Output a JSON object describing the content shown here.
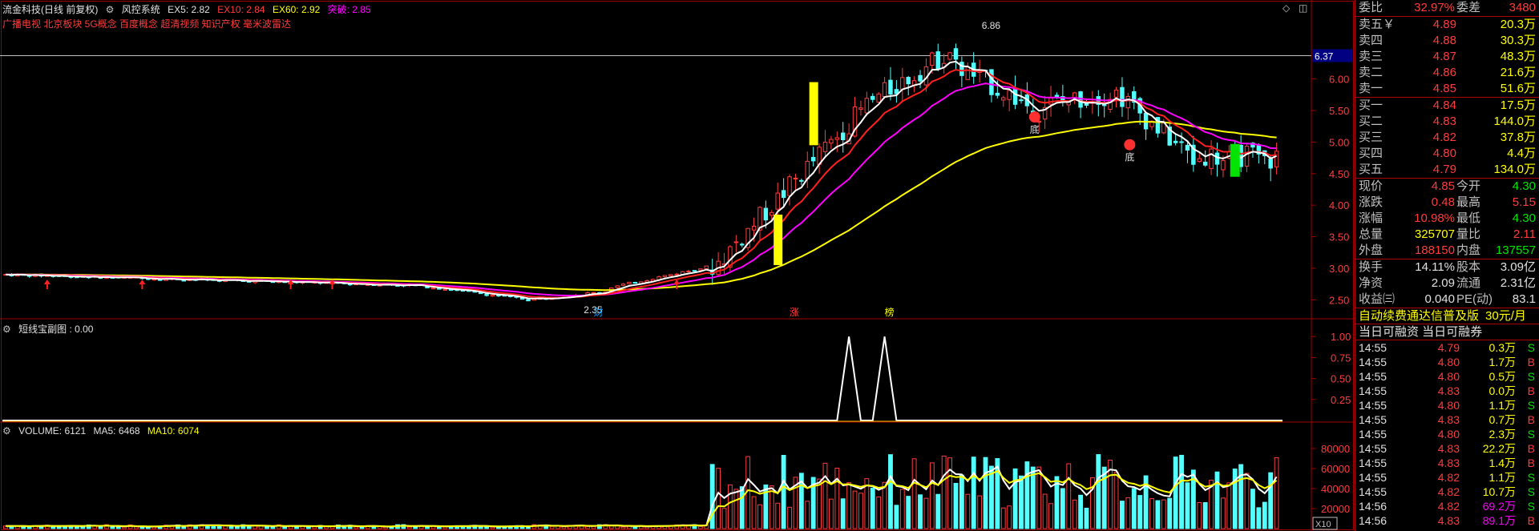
{
  "header": {
    "title": "流金科技(日线 前复权)",
    "indicator_name": "风控系统",
    "ex5": "EX5: 2.82",
    "ex10": "EX10: 2.84",
    "ex60": "EX60: 2.92",
    "breakout": "突破: 2.85",
    "concepts": "广播电视 北京板块 5G概念 百度概念 超清视频 知识产权 毫米波雷达"
  },
  "main_chart": {
    "price_axis": [
      "6.00",
      "5.50",
      "5.00",
      "4.50",
      "4.00",
      "3.50",
      "3.00",
      "2.50"
    ],
    "price_min": 2.2,
    "price_max": 7.15,
    "current_price_tag": "6.37",
    "high_label": "6.86",
    "low_label": "2.35",
    "markers": [
      {
        "text": "财",
        "color": "#00a0ff"
      },
      {
        "text": "涨",
        "color": "#ff3c3c"
      },
      {
        "text": "榜",
        "color": "#ffff00"
      }
    ],
    "signal_labels": [
      "底",
      "底"
    ]
  },
  "sub_chart": {
    "title": "短线宝副图 : 0.00",
    "axis": [
      "1.00",
      "0.75",
      "0.50",
      "0.25"
    ]
  },
  "volume_chart": {
    "title": "VOLUME: 6121",
    "ma5": "MA5: 6468",
    "ma10": "MA10: 6074",
    "axis": [
      "80000",
      "60000",
      "40000",
      "20000"
    ],
    "unit": "X10",
    "vmax": 92000
  },
  "colors": {
    "up": "#ff3c3c",
    "down": "#54ffff",
    "ma5": "#ffffff",
    "ma10": "#ff2020",
    "ma20": "#ff00ff",
    "ma60": "#ffff00"
  },
  "quote": {
    "weibi_label": "委比",
    "weibi_value": "32.97%",
    "weicha_label": "委差",
    "weicha_value": "3480",
    "sells": [
      {
        "label": "卖五￥",
        "price": "4.89",
        "vol": "20.3万"
      },
      {
        "label": "卖四",
        "price": "4.88",
        "vol": "30.3万"
      },
      {
        "label": "卖三",
        "price": "4.87",
        "vol": "48.3万"
      },
      {
        "label": "卖二",
        "price": "4.86",
        "vol": "21.6万"
      },
      {
        "label": "卖一",
        "price": "4.85",
        "vol": "51.6万"
      }
    ],
    "buys": [
      {
        "label": "买一",
        "price": "4.84",
        "vol": "17.5万"
      },
      {
        "label": "买二",
        "price": "4.83",
        "vol": "144.0万"
      },
      {
        "label": "买三",
        "price": "4.82",
        "vol": "37.8万"
      },
      {
        "label": "买四",
        "price": "4.80",
        "vol": "4.4万"
      },
      {
        "label": "买五",
        "price": "4.79",
        "vol": "134.0万"
      }
    ],
    "stats": [
      {
        "l1": "现价",
        "v1": "4.85",
        "l2": "今开",
        "v2": "4.30"
      },
      {
        "l1": "涨跌",
        "v1": "0.48",
        "l2": "最高",
        "v2": "5.15"
      },
      {
        "l1": "涨幅",
        "v1": "10.98%",
        "l2": "最低",
        "v2": "4.30"
      },
      {
        "l1": "总量",
        "v1": "325707",
        "l2": "量比",
        "v2": "2.11"
      },
      {
        "l1": "外盘",
        "v1": "188150",
        "l2": "内盘",
        "v2": "137557"
      }
    ],
    "stats2": [
      {
        "l1": "换手",
        "v1": "14.11%",
        "l2": "股本",
        "v2": "3.09亿"
      },
      {
        "l1": "净资",
        "v1": "2.09",
        "l2": "流通",
        "v2": "2.31亿"
      },
      {
        "l1": "收益㈢",
        "v1": "0.040",
        "l2": "PE(动)",
        "v2": "83.1"
      }
    ],
    "banner_text": "自动续费通达信普及版",
    "banner_price": "30元/月",
    "margin_text": "当日可融资 当日可融券"
  },
  "ticks": [
    {
      "time": "14:55",
      "price": "4.79",
      "vol": "0.3万",
      "side": "S"
    },
    {
      "time": "14:55",
      "price": "4.80",
      "vol": "1.7万",
      "side": "B"
    },
    {
      "time": "14:55",
      "price": "4.80",
      "vol": "0.5万",
      "side": "S"
    },
    {
      "time": "14:55",
      "price": "4.83",
      "vol": "0.0万",
      "side": "B"
    },
    {
      "time": "14:55",
      "price": "4.80",
      "vol": "1.1万",
      "side": "S"
    },
    {
      "time": "14:55",
      "price": "4.83",
      "vol": "0.7万",
      "side": "B"
    },
    {
      "time": "14:55",
      "price": "4.80",
      "vol": "2.3万",
      "side": "S"
    },
    {
      "time": "14:55",
      "price": "4.83",
      "vol": "22.2万",
      "side": "B"
    },
    {
      "time": "14:55",
      "price": "4.83",
      "vol": "1.4万",
      "side": "B"
    },
    {
      "time": "14:55",
      "price": "4.82",
      "vol": "1.1万",
      "side": "S"
    },
    {
      "time": "14:55",
      "price": "4.82",
      "vol": "10.7万",
      "side": "S"
    },
    {
      "time": "14:56",
      "price": "4.82",
      "vol": "69.2万",
      "side": "S"
    },
    {
      "time": "14:56",
      "price": "4.83",
      "vol": "89.1万",
      "side": "B"
    }
  ]
}
